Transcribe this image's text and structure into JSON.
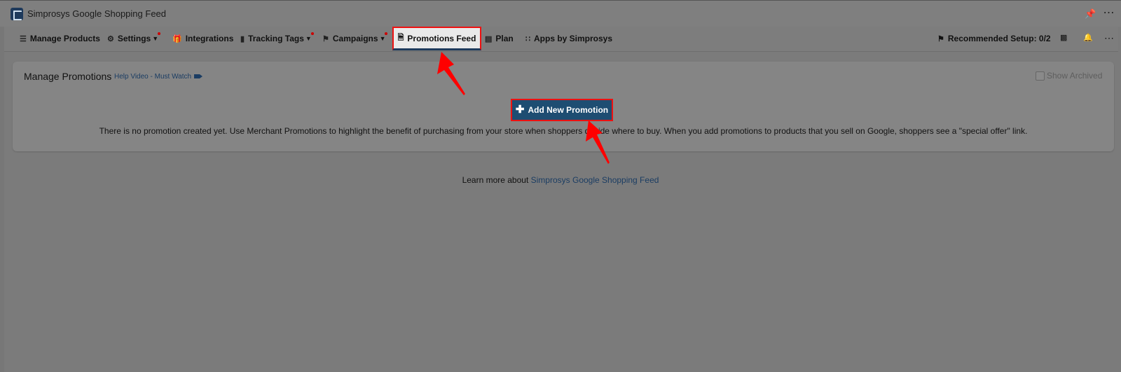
{
  "app": {
    "title": "Simprosys Google Shopping Feed"
  },
  "nav": {
    "items": [
      {
        "label": "Manage Products",
        "icon": "list-icon"
      },
      {
        "label": "Settings",
        "icon": "gear-icon",
        "has_dropdown": true,
        "has_badge": true
      },
      {
        "label": "Integrations",
        "icon": "gift-icon"
      },
      {
        "label": "Tracking Tags",
        "icon": "bar-chart-icon",
        "has_dropdown": true,
        "has_badge": true
      },
      {
        "label": "Campaigns",
        "icon": "tag-icon",
        "has_dropdown": true,
        "has_badge": true
      },
      {
        "label": "Promotions Feed",
        "icon": "document-icon",
        "active": true
      },
      {
        "label": "Plan",
        "icon": "card-icon"
      },
      {
        "label": "Apps by Simprosys",
        "icon": "grid-icon"
      }
    ],
    "recommended_setup": "Recommended Setup: 0/2"
  },
  "promotions": {
    "title": "Manage Promotions",
    "help_link": "Help Video - Must Watch",
    "show_archived": "Show Archived",
    "add_button": "Add New Promotion",
    "empty_message": "There is no promotion created yet. Use Merchant Promotions to highlight the benefit of purchasing from your store when shoppers decide where to buy. When you add promotions to products that you sell on Google, shoppers see a \"special offer\" link."
  },
  "footer": {
    "learn_prefix": "Learn more about",
    "learn_link": "Simprosys Google Shopping Feed"
  },
  "colors": {
    "accent": "#1e4d72",
    "highlight_border": "#ee1111",
    "link": "#1b3d63"
  }
}
